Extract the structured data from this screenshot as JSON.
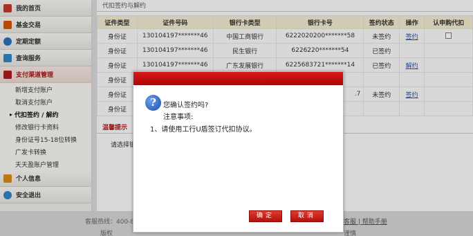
{
  "sidebar": {
    "items": [
      {
        "label": "我的首页",
        "icon": "home-icon",
        "color": "#c0392b"
      },
      {
        "label": "基金交易",
        "icon": "fund-icon",
        "color": "#d35400"
      },
      {
        "label": "定期定额",
        "icon": "clock-icon",
        "color": "#2c6fb5"
      },
      {
        "label": "查询服务",
        "icon": "book-icon",
        "color": "#2e86c1"
      },
      {
        "label": "支付渠道管理",
        "icon": "payment-icon",
        "color": "#b01818"
      }
    ],
    "subitems": [
      "新增支付账户",
      "取消支付账户",
      "代扣签约 / 解约",
      "修改银行卡资料",
      "身份证号15-18位转换",
      "广发卡转换",
      "天天盈账户管理"
    ],
    "bottom_items": [
      {
        "label": "个人信息",
        "icon": "person-icon",
        "color": "#d68910"
      },
      {
        "label": "安全退出",
        "icon": "power-icon",
        "color": "#2e86c1"
      }
    ]
  },
  "main": {
    "title": "代扣签约与解约",
    "table": {
      "headers": [
        "证件类型",
        "证件号码",
        "银行卡类型",
        "银行卡号",
        "签约状态",
        "操作",
        "认申购代扣"
      ],
      "rows": [
        [
          "身份证",
          "130104197*******46",
          "中国工商银行",
          "6222020200*******58",
          "未签约",
          "签约",
          ""
        ],
        [
          "身份证",
          "130104197*******46",
          "民生银行",
          "6226220*******54",
          "已签约",
          "",
          ""
        ],
        [
          "身份证",
          "130104197*******46",
          "广东发展银行",
          "6225683721*******14",
          "已签约",
          "解约",
          ""
        ],
        [
          "身份证",
          "",
          "",
          "",
          "",
          "",
          ""
        ],
        [
          "身份证",
          "",
          "",
          ".7",
          "未签约",
          "签约",
          ""
        ],
        [
          "身份证",
          "",
          "",
          "",
          "",
          "",
          ""
        ]
      ]
    },
    "tip_title": "温馨提示",
    "tip_text": "请选择银"
  },
  "footer": {
    "hotline": "客服热线：400-8",
    "copyright": "版权",
    "links": "客服 | 帮助手册",
    "tail": "谨慎"
  },
  "dialog": {
    "question": "您确认签约吗?",
    "notice_label": "注意事项:",
    "item1": "1、请使用工行U盾签订代扣协议。",
    "ok_label": "确定",
    "cancel_label": "取消",
    "colors": {
      "title_bar": "#c41010",
      "button": "#c81f1f"
    }
  }
}
